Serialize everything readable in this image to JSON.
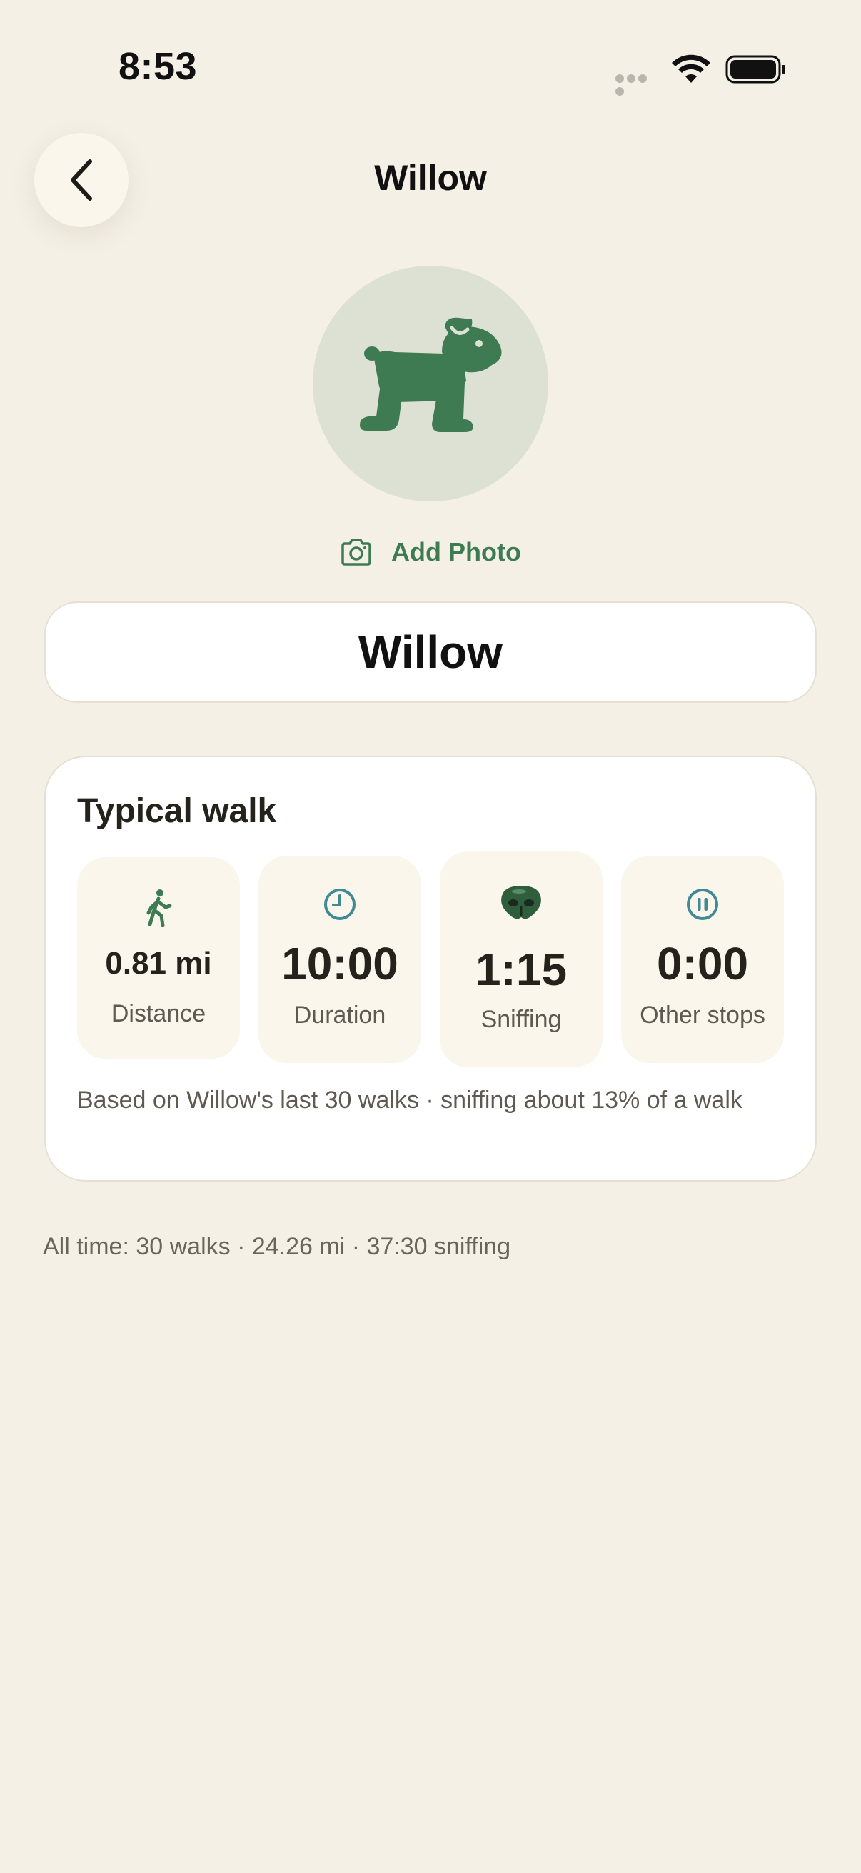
{
  "status_bar": {
    "time": "8:53"
  },
  "nav": {
    "back_icon": "chevron-left-icon",
    "title": "Willow"
  },
  "avatar": {
    "icon": "dog-icon",
    "add_photo_label": "Add Photo"
  },
  "name_field": {
    "value": "Willow"
  },
  "typical_walk": {
    "title": "Typical walk",
    "stats": [
      {
        "icon": "walking-person-icon",
        "value": "0.81 mi",
        "label": "Distance"
      },
      {
        "icon": "clock-icon",
        "value": "10:00",
        "label": "Duration"
      },
      {
        "icon": "dog-nose-icon",
        "value": "1:15",
        "label": "Sniffing"
      },
      {
        "icon": "pause-icon",
        "value": "0:00",
        "label": "Other stops"
      }
    ],
    "note": "Based on Willow's last 30 walks · sniffing about 13% of a walk"
  },
  "all_time": "All time: 30 walks · 24.26 mi · 37:30 sniffing",
  "colors": {
    "background": "#f4f0e6",
    "accent_green": "#3f7b52",
    "accent_teal": "#3f8a94",
    "card": "#ffffff",
    "tile": "#faf6ec",
    "avatar_bg": "#dde1d3"
  }
}
